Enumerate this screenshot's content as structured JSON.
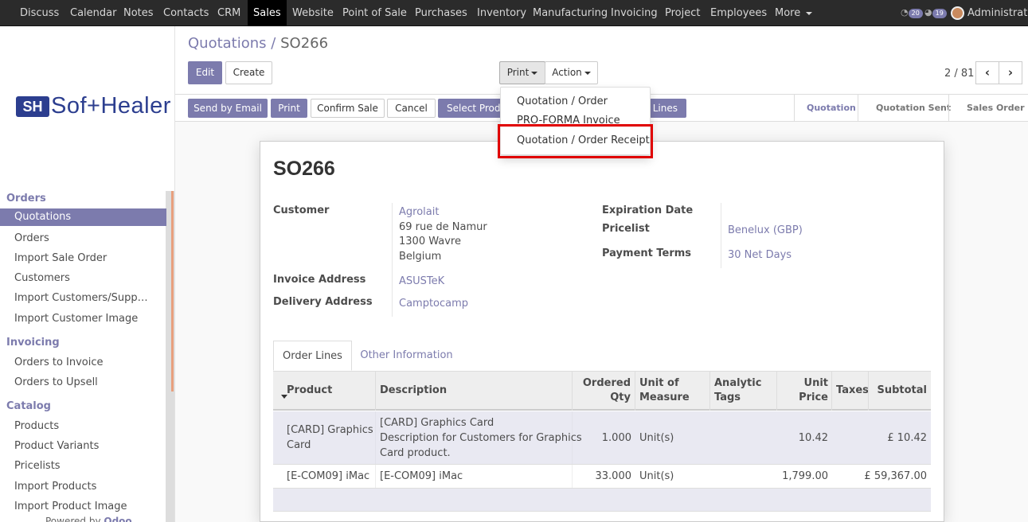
{
  "topnav": {
    "items": [
      "Discuss",
      "Calendar",
      "Notes",
      "Contacts",
      "CRM",
      "Sales",
      "Website",
      "Point of Sale",
      "Purchases",
      "Inventory",
      "Manufacturing",
      "Invoicing",
      "Project",
      "Employees",
      "More"
    ],
    "active": "Sales",
    "badge_messages": "20",
    "badge_activities": "19",
    "user": "Administrator"
  },
  "logo": {
    "mark": "SH",
    "text": "Sof+Healer"
  },
  "sidebar": {
    "sections": [
      {
        "label": "Orders",
        "items": [
          "Quotations",
          "Orders",
          "Import Sale Order",
          "Customers",
          "Import Customers/Suppli…",
          "Import Customer Image"
        ]
      },
      {
        "label": "Invoicing",
        "items": [
          "Orders to Invoice",
          "Orders to Upsell"
        ]
      },
      {
        "label": "Catalog",
        "items": [
          "Products",
          "Product Variants",
          "Pricelists",
          "Import Products",
          "Import Product Image"
        ]
      }
    ],
    "active_item": "Quotations",
    "powered_by": "Powered by",
    "powered_brand": "Odoo"
  },
  "breadcrumb": {
    "parent": "Quotations",
    "separator": "/",
    "current": "SO266"
  },
  "controls": {
    "edit": "Edit",
    "create": "Create",
    "print": "Print",
    "action": "Action"
  },
  "pager": {
    "value": "2 / 81",
    "prev_icon": "chevron-left-icon",
    "next_icon": "chevron-right-icon",
    "prev_glyph": "‹",
    "next_glyph": "›"
  },
  "statusbar": {
    "buttons": [
      "Send by Email",
      "Print",
      "Confirm Sale",
      "Cancel",
      "Select Products",
      "Order Lines"
    ],
    "stages": [
      "Quotation",
      "Quotation Sent",
      "Sales Order"
    ],
    "current_stage": "Quotation"
  },
  "print_menu": {
    "items": [
      "Quotation / Order",
      "PRO-FORMA Invoice",
      "Quotation / Order Receipt"
    ],
    "highlighted": "Quotation / Order Receipt"
  },
  "form": {
    "name": "SO266",
    "customer_label": "Customer",
    "customer_name": "Agrolait",
    "customer_address": [
      "69 rue de Namur",
      "1300 Wavre",
      "Belgium"
    ],
    "invoice_address_label": "Invoice Address",
    "invoice_address": "ASUSTeK",
    "delivery_address_label": "Delivery Address",
    "delivery_address": "Camptocamp",
    "expiration_label": "Expiration Date",
    "expiration_value": "",
    "pricelist_label": "Pricelist",
    "pricelist_value": "Benelux (GBP)",
    "payment_terms_label": "Payment Terms",
    "payment_terms_value": "30 Net Days"
  },
  "tabs": [
    "Order Lines",
    "Other Information"
  ],
  "order_lines": {
    "columns": [
      "Product",
      "Description",
      "Ordered Qty",
      "Unit of Measure",
      "Analytic Tags",
      "Unit Price",
      "Taxes",
      "Subtotal"
    ],
    "column_lines": [
      [
        "Product"
      ],
      [
        "Description"
      ],
      [
        "Ordered",
        "Qty"
      ],
      [
        "Unit of",
        "Measure"
      ],
      [
        "Analytic",
        "Tags"
      ],
      [
        "Unit",
        "Price"
      ],
      [
        "Taxes"
      ],
      [
        "Subtotal"
      ]
    ],
    "rows": [
      {
        "product": [
          "[CARD] Graphics",
          "Card"
        ],
        "description": [
          "[CARD] Graphics Card",
          "Description for Customers for Graphics",
          "Card product."
        ],
        "qty": "1.000",
        "uom": "Unit(s)",
        "tags": "",
        "price": "10.42",
        "taxes": "",
        "subtotal": "£ 10.42"
      },
      {
        "product": [
          "[E-COM09] iMac"
        ],
        "description": [
          "[E-COM09] iMac"
        ],
        "qty": "33.000",
        "uom": "Unit(s)",
        "tags": "",
        "price": "1,799.00",
        "taxes": "",
        "subtotal": "£ 59,367.00"
      }
    ]
  },
  "colors": {
    "primary": "#7c7bad",
    "nav": "#2b2b2b",
    "highlight": "#e00000"
  }
}
